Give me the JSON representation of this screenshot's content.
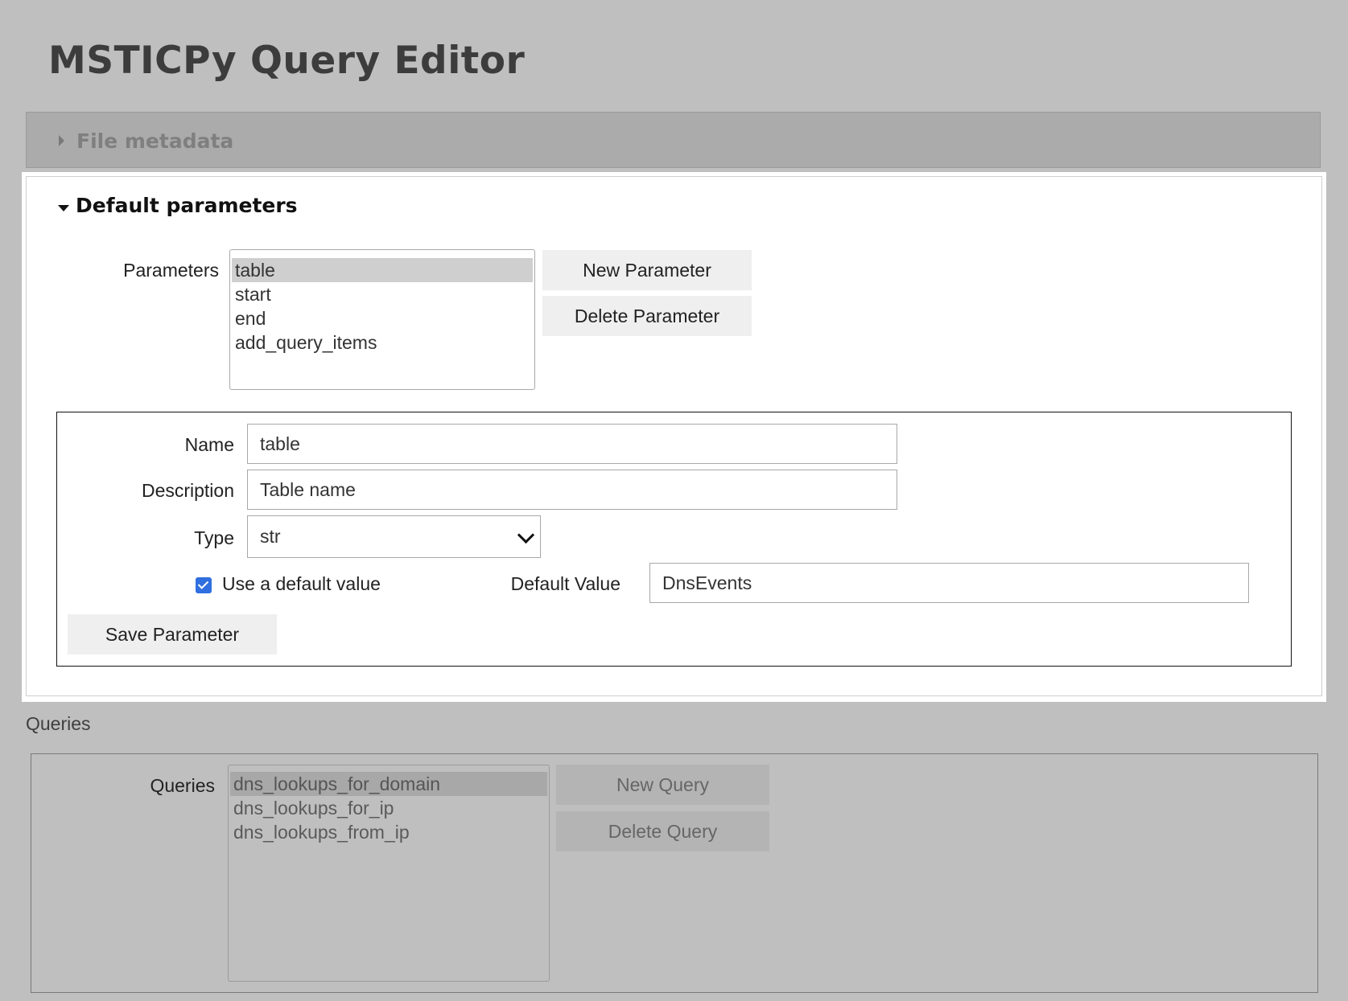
{
  "app": {
    "title": "MSTICPy Query Editor"
  },
  "file_metadata": {
    "label": "File metadata",
    "expanded": false
  },
  "default_parameters": {
    "label": "Default parameters",
    "expanded": true,
    "list_label": "Parameters",
    "items": [
      "table",
      "start",
      "end",
      "add_query_items"
    ],
    "selected": "table",
    "new_button": "New Parameter",
    "delete_button": "Delete Parameter",
    "form": {
      "name_label": "Name",
      "name_value": "table",
      "description_label": "Description",
      "description_value": "Table name",
      "type_label": "Type",
      "type_value": "str",
      "use_default_label": "Use a default value",
      "use_default_checked": true,
      "default_value_label": "Default Value",
      "default_value": "DnsEvents",
      "save_button": "Save Parameter"
    }
  },
  "queries": {
    "section_label": "Queries",
    "list_label": "Queries",
    "items": [
      "dns_lookups_for_domain",
      "dns_lookups_for_ip",
      "dns_lookups_from_ip"
    ],
    "selected": "dns_lookups_for_domain",
    "new_button": "New Query",
    "delete_button": "Delete Query"
  },
  "colors": {
    "overlay": "#bfbfbf",
    "checkbox_accent": "#2f6fe0",
    "selection": "#cfcfcf"
  }
}
